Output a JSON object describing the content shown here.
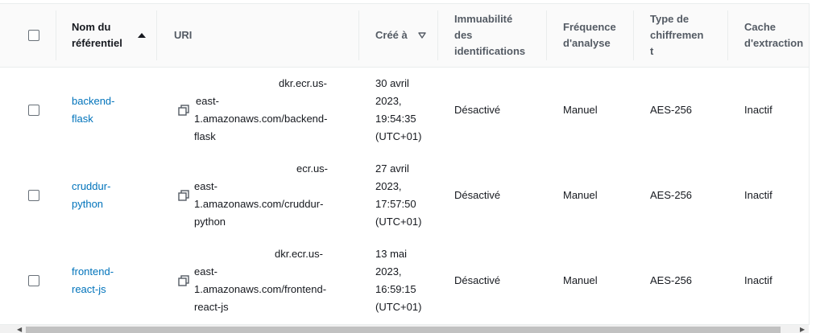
{
  "table": {
    "columns": {
      "repo_name": [
        "Nom du",
        "référentiel"
      ],
      "uri": "URI",
      "created": "Créé à",
      "immutability": [
        "Immuabilité",
        "des",
        "identifications"
      ],
      "scan": [
        "Fréquence",
        "d'analyse"
      ],
      "encryption": [
        "Type de",
        "chiffremen",
        "t"
      ],
      "cache": [
        "Cache",
        "d'extraction"
      ]
    },
    "rows": [
      {
        "name": [
          "backend-",
          "flask"
        ],
        "uri": [
          "dkr.ecr.us-",
          "east-",
          "1.amazonaws.com/backend-",
          "flask"
        ],
        "created": [
          "30 avril",
          "2023,",
          "19:54:35",
          "(UTC+01)"
        ],
        "immutability": "Désactivé",
        "scan": "Manuel",
        "encryption": "AES-256",
        "cache": "Inactif"
      },
      {
        "name": [
          "cruddur-",
          "python"
        ],
        "uri": [
          "ecr.us-",
          "east-",
          "1.amazonaws.com/cruddur-",
          "python"
        ],
        "created": [
          "27 avril",
          "2023,",
          "17:57:50",
          "(UTC+01)"
        ],
        "immutability": "Désactivé",
        "scan": "Manuel",
        "encryption": "AES-256",
        "cache": "Inactif"
      },
      {
        "name": [
          "frontend-",
          "react-js"
        ],
        "uri": [
          "dkr.ecr.us-",
          "east-",
          "1.amazonaws.com/frontend-",
          "react-js"
        ],
        "created": [
          "13 mai",
          "2023,",
          "16:59:15",
          "(UTC+01)"
        ],
        "immutability": "Désactivé",
        "scan": "Manuel",
        "encryption": "AES-256",
        "cache": "Inactif"
      }
    ]
  },
  "icons": {
    "sort_asc": "caret-up-icon",
    "sort_desc": "caret-down-icon",
    "copy": "copy-icon",
    "scroll_left": "arrow-left-icon",
    "scroll_right": "arrow-right-icon"
  }
}
